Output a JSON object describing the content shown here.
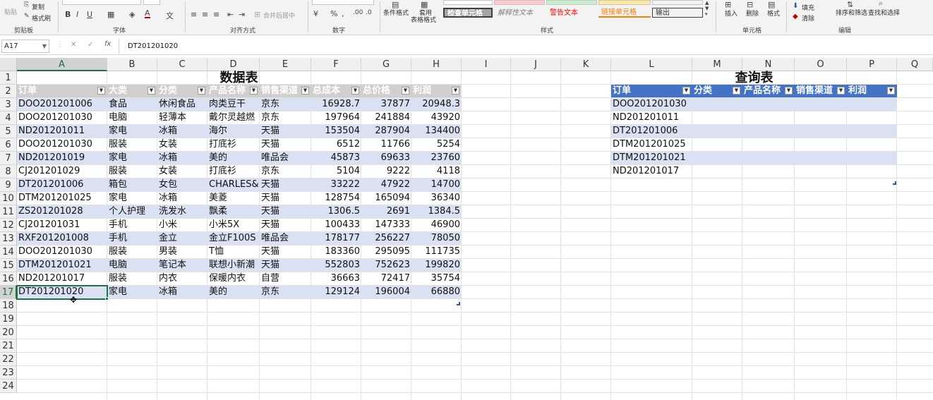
{
  "ribbon": {
    "clipboard": {
      "paste": "粘贴",
      "copy": "复制",
      "format_painter": "格式刷",
      "label": "剪贴板"
    },
    "font": {
      "label": "字体"
    },
    "alignment": {
      "merge_center": "合并后居中",
      "label": "对齐方式"
    },
    "number": {
      "label": "数字"
    },
    "styles": {
      "conditional_format": "条件格式",
      "format_as_table_1": "套用",
      "format_as_table_2": "表格格式",
      "check_cell": "检查单元格",
      "explanatory": "解释性文本",
      "warning": "警告文本",
      "linked_cell": "链接单元格",
      "output": "输出",
      "label": "样式"
    },
    "cells": {
      "insert": "插入",
      "delete": "删除",
      "format": "格式",
      "label": "单元格"
    },
    "editing": {
      "fill": "填充",
      "clear": "清除",
      "sort_filter": "排序和筛选",
      "find_select": "查找和选择",
      "label": "编辑"
    }
  },
  "formula_bar": {
    "name_box": "A17",
    "fx": "fx",
    "content": "DT201201020"
  },
  "columns": [
    "A",
    "B",
    "C",
    "D",
    "E",
    "F",
    "G",
    "H",
    "I",
    "J",
    "K",
    "L",
    "M",
    "N",
    "O",
    "P",
    "Q"
  ],
  "rows": [
    "1",
    "2",
    "3",
    "4",
    "5",
    "6",
    "7",
    "8",
    "9",
    "10",
    "11",
    "12",
    "13",
    "14",
    "15",
    "16",
    "17",
    "18",
    "19",
    "20",
    "21",
    "22",
    "23",
    "24"
  ],
  "selected": {
    "column": "A",
    "row": "17"
  },
  "data_table": {
    "title": "数据表",
    "headers": [
      "订单",
      "大类",
      "分类",
      "产品名称",
      "销售渠道",
      "总成本",
      "总价格",
      "利润"
    ],
    "rows": [
      [
        "DOO201201006",
        "食品",
        "休闲食品",
        "肉类豆干",
        "京东",
        "16928.7",
        "37877",
        "20948.3"
      ],
      [
        "DOO201201030",
        "电脑",
        "轻薄本",
        "戴尔灵越燃",
        "京东",
        "197964",
        "241884",
        "43920"
      ],
      [
        "ND201201011",
        "家电",
        "冰箱",
        "海尔",
        "天猫",
        "153504",
        "287904",
        "134400"
      ],
      [
        "DOO201201030",
        "服装",
        "女装",
        "打底衫",
        "天猫",
        "6512",
        "11766",
        "5254"
      ],
      [
        "ND201201019",
        "家电",
        "冰箱",
        "美的",
        "唯品会",
        "45873",
        "69633",
        "23760"
      ],
      [
        "CJ201201029",
        "服装",
        "女装",
        "打底衫",
        "京东",
        "5104",
        "9222",
        "4118"
      ],
      [
        "DT201201006",
        "箱包",
        "女包",
        "CHARLES&",
        "天猫",
        "33222",
        "47922",
        "14700"
      ],
      [
        "DTM201201025",
        "家电",
        "冰箱",
        "美菱",
        "天猫",
        "128754",
        "165094",
        "36340"
      ],
      [
        "ZS201201028",
        "个人护理",
        "洗发水",
        "飘柔",
        "天猫",
        "1306.5",
        "2691",
        "1384.5"
      ],
      [
        "CJ201201031",
        "手机",
        "小米",
        "小米5X",
        "天猫",
        "100433",
        "147333",
        "46900"
      ],
      [
        "RXF201201008",
        "手机",
        "金立",
        "金立F100S",
        "唯品会",
        "178177",
        "256227",
        "78050"
      ],
      [
        "DOO201201030",
        "服装",
        "男装",
        "T恤",
        "天猫",
        "183360",
        "295095",
        "111735"
      ],
      [
        "DTM201201021",
        "电脑",
        "笔记本",
        "联想小新潮",
        "天猫",
        "552803",
        "752623",
        "199820"
      ],
      [
        "ND201201017",
        "服装",
        "内衣",
        "保暖内衣",
        "自营",
        "36663",
        "72417",
        "35754"
      ],
      [
        "DT201201020",
        "家电",
        "冰箱",
        "美的",
        "京东",
        "129124",
        "196004",
        "66880"
      ]
    ]
  },
  "query_table": {
    "title": "查询表",
    "headers": [
      "订单",
      "分类",
      "产品名称",
      "销售渠道",
      "利润"
    ],
    "orders": [
      "DOO201201030",
      "ND201201011",
      "DT201201006",
      "DTM201201025",
      "DTM201201021",
      "ND201201017"
    ]
  },
  "colors": {
    "header_gray": "#d0cece",
    "query_header": "#4472c4",
    "band": "#d9e1f2",
    "selection": "#217346"
  }
}
